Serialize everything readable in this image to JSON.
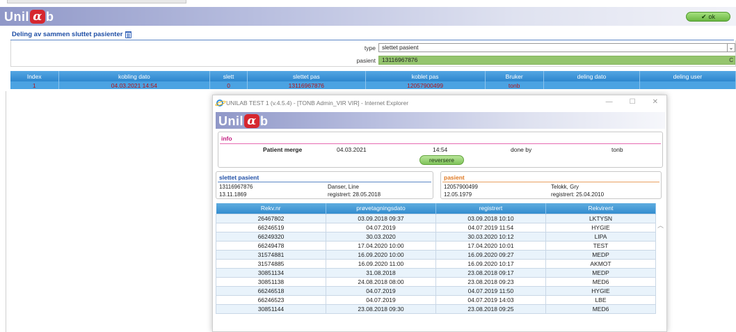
{
  "app": {
    "logo_text_before": "Unil",
    "logo_alpha": "α",
    "logo_text_after": "b",
    "ok_label": "ok"
  },
  "section": {
    "title": "Deling av sammen sluttet pasienter"
  },
  "form": {
    "type_label": "type",
    "type_value": "slettet pasient",
    "pasient_label": "pasient",
    "pasient_value": "13116967876"
  },
  "main_table": {
    "headers": [
      "Index",
      "kobling dato",
      "slett",
      "slettet pas",
      "koblet pas",
      "Bruker",
      "deling dato",
      "deling user"
    ],
    "rows": [
      [
        "1",
        "04.03.2021 14:54",
        "0",
        "13116967876",
        "12057900499",
        "tonb",
        "",
        ""
      ]
    ]
  },
  "popup": {
    "window_title": "UNILAB TEST 1 (v.4.5.4) - [TONB Admin_VIR VIR] - Internet Explorer",
    "info": {
      "title": "info",
      "label": "Patient merge",
      "date": "04.03.2021",
      "time": "14:54",
      "done_by_label": "done by",
      "done_by_value": "tonb",
      "reverse_label": "reversere"
    },
    "deleted_patient": {
      "title": "slettet pasient",
      "id": "13116967876",
      "name": "Danser, Line",
      "birthdate": "13.11.1869",
      "registered": "registrert: 28.05.2018"
    },
    "patient": {
      "title": "pasient",
      "id": "12057900499",
      "name": "Telokk, Gry",
      "birthdate": "12.05.1979",
      "registered": "registrert: 25.04.2010"
    },
    "table": {
      "headers": [
        "Rekv.nr",
        "prøvetagningsdato",
        "registrert",
        "Rekvirent"
      ],
      "rows": [
        [
          "26467802",
          "03.09.2018 09:37",
          "03.09.2018 10:10",
          "LKTYSN"
        ],
        [
          "66246519",
          "04.07.2019",
          "04.07.2019 11:54",
          "HYGIE"
        ],
        [
          "66249320",
          "30.03.2020",
          "30.03.2020 10:12",
          "LIPA"
        ],
        [
          "66249478",
          "17.04.2020 10:00",
          "17.04.2020 10:01",
          "TEST"
        ],
        [
          "31574881",
          "16.09.2020 10:00",
          "16.09.2020 09:27",
          "MEDP"
        ],
        [
          "31574885",
          "16.09.2020 11:00",
          "16.09.2020 10:17",
          "AKMOT"
        ],
        [
          "30851134",
          "31.08.2018",
          "23.08.2018 09:17",
          "MEDP"
        ],
        [
          "30851138",
          "24.08.2018 08:00",
          "23.08.2018 09:23",
          "MED6"
        ],
        [
          "66246518",
          "04.07.2019",
          "04.07.2019 11:50",
          "HYGIE"
        ],
        [
          "66246523",
          "04.07.2019",
          "04.07.2019 14:03",
          "LBE"
        ],
        [
          "30851144",
          "23.08.2018 09:30",
          "23.08.2018 09:25",
          "MED6"
        ]
      ]
    }
  },
  "colors": {
    "accent_blue": "#2d87ce",
    "ok_green": "#6cb744",
    "info_pink": "#c2197e",
    "deleted_blue": "#1f4fa6",
    "patient_orange": "#e07a24"
  }
}
